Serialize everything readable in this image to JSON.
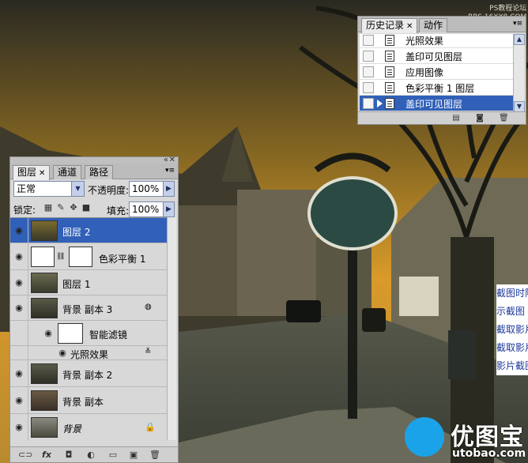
{
  "watermark": {
    "line1": "PS教程论坛",
    "line2": "BBS.16XX8.COM"
  },
  "logo": {
    "cn": "优图宝",
    "en": "utobao.com"
  },
  "side_text": [
    "截图时隐",
    "示截图",
    "截取影片",
    "截取影片",
    "影片截图"
  ],
  "history": {
    "tabs": [
      {
        "label": "历史记录"
      },
      {
        "label": "动作"
      }
    ],
    "items": [
      {
        "label": "光照效果"
      },
      {
        "label": "盖印可见图层"
      },
      {
        "label": "应用图像"
      },
      {
        "label": "色彩平衡 1 图层"
      },
      {
        "label": "盖印可见图层"
      }
    ],
    "footer_icons": [
      "new-snapshot-icon",
      "camera-icon",
      "trash-icon"
    ]
  },
  "layers": {
    "tabs": [
      {
        "label": "图层"
      },
      {
        "label": "通道"
      },
      {
        "label": "路径"
      }
    ],
    "blend_mode": "正常",
    "opacity_label": "不透明度:",
    "opacity_value": "100%",
    "lock_label": "锁定:",
    "fill_label": "填充:",
    "fill_value": "100%",
    "rows": [
      {
        "name": "图层 2",
        "selected": true
      },
      {
        "name": "色彩平衡 1"
      },
      {
        "name": "图层 1"
      },
      {
        "name": "背景 副本 3"
      },
      {
        "name": "智能滤镜"
      },
      {
        "name": "光照效果"
      },
      {
        "name": "背景 副本 2"
      },
      {
        "name": "背景 副本"
      },
      {
        "name": "背景"
      }
    ],
    "footer_icons": [
      "link-icon",
      "fx-icon",
      "mask-icon",
      "adjustment-icon",
      "folder-icon",
      "new-layer-icon",
      "trash-icon"
    ]
  },
  "colors": {
    "selection": "#3160b8",
    "panel": "#d8d8d8",
    "sky": "#d99a2a"
  }
}
